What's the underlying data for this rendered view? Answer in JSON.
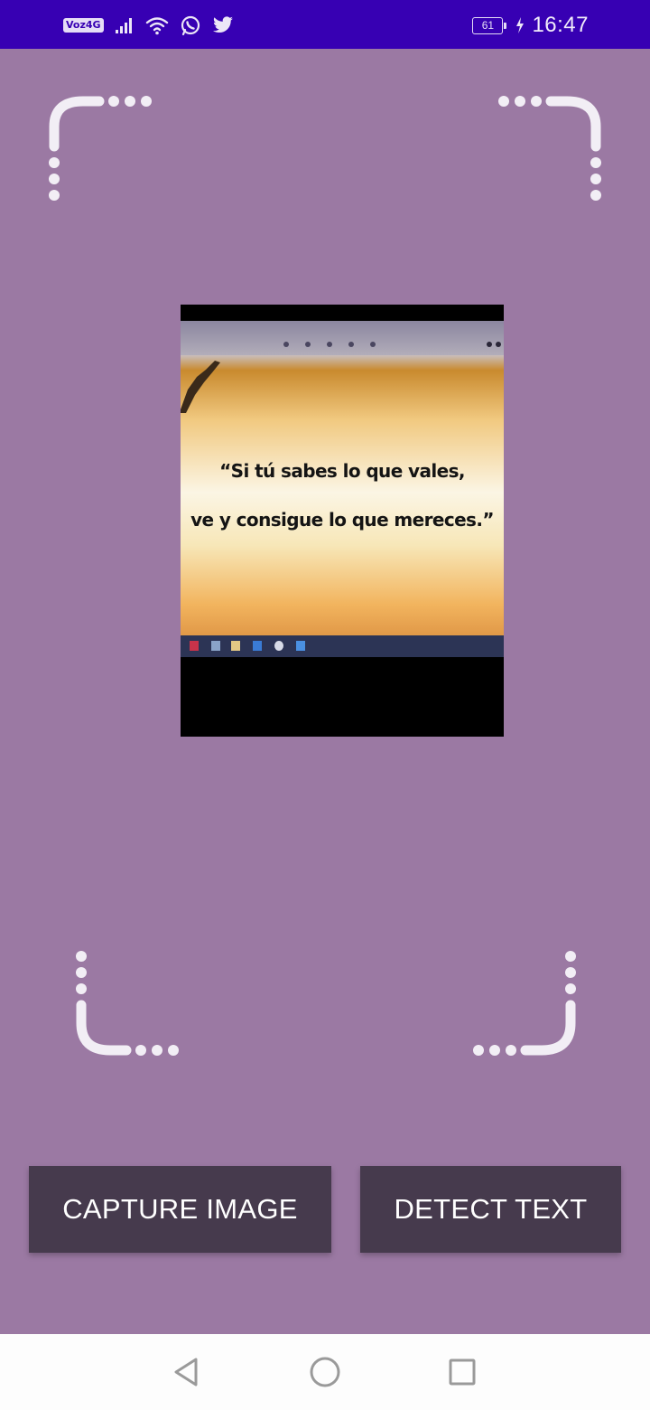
{
  "status_bar": {
    "time": "16:47",
    "battery_level": "61",
    "volte_label": "Voz4G",
    "icons": [
      "volte-icon",
      "signal-icon",
      "wifi-icon",
      "whatsapp-icon",
      "twitter-icon",
      "battery-icon",
      "charging-icon"
    ]
  },
  "viewfinder": {
    "corner_color": "#f2eef5",
    "icons": [
      "corner-top-left",
      "corner-top-right",
      "corner-bottom-left",
      "corner-bottom-right"
    ]
  },
  "preview_image": {
    "quote_line1": "“Si tú sabes lo que vales,",
    "quote_line2": "ve y consigue lo que mereces.”"
  },
  "buttons": {
    "capture_label": "CAPTURE IMAGE",
    "detect_label": "DETECT TEXT"
  },
  "nav_bar": {
    "icons": [
      "back-icon",
      "home-icon",
      "recents-icon"
    ]
  },
  "colors": {
    "status_bar": "#3700b3",
    "background": "#9b79a3",
    "button": "#463a4d",
    "button_text": "#ffffff",
    "nav_bar": "#fdfdfd"
  }
}
